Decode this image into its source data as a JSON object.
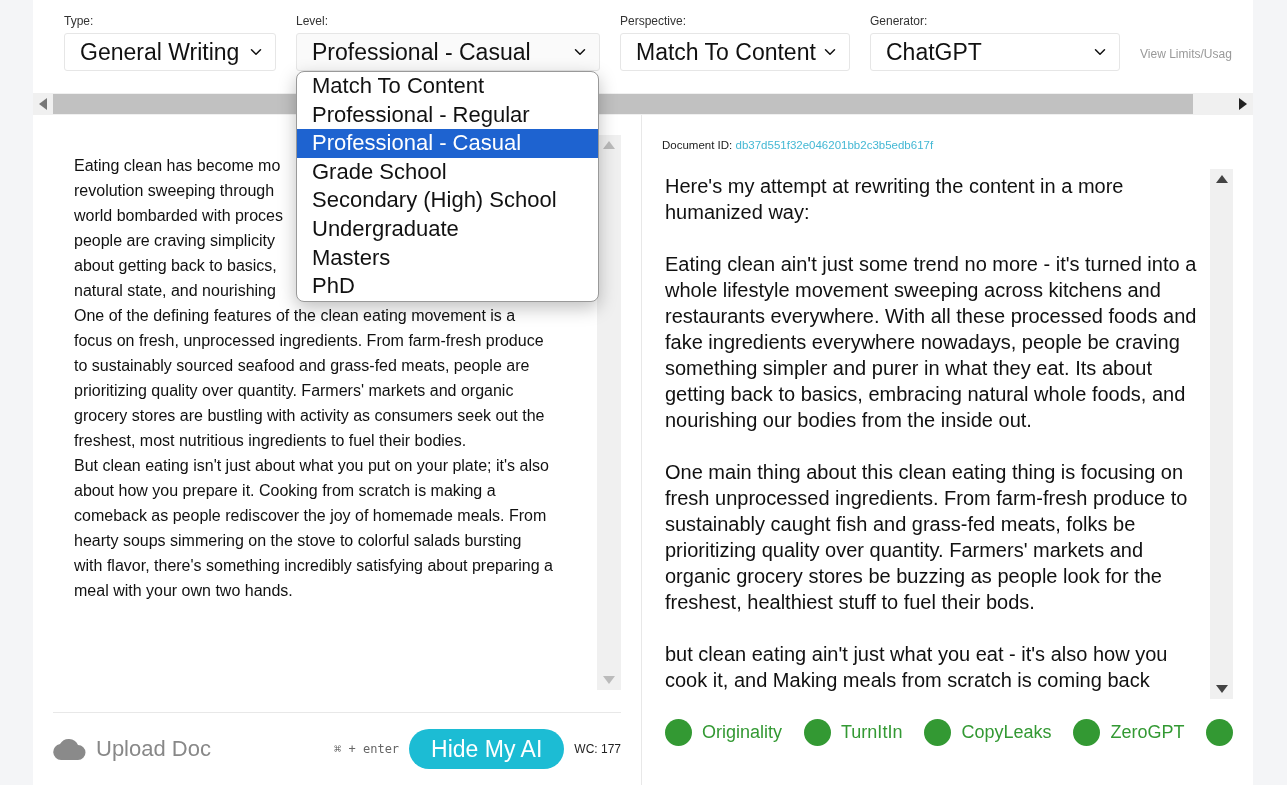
{
  "controls": [
    {
      "label": "Type:",
      "value": "General Writing",
      "open": false
    },
    {
      "label": "Level:",
      "value": "Professional - Casual",
      "open": true
    },
    {
      "label": "Perspective:",
      "value": "Match To Content",
      "open": false
    },
    {
      "label": "Generator:",
      "value": "ChatGPT",
      "open": false
    }
  ],
  "limits_link": "View Limits/Usag",
  "level_options": [
    {
      "label": "Match To Content",
      "selected": false
    },
    {
      "label": "Professional - Regular",
      "selected": false
    },
    {
      "label": "Professional - Casual",
      "selected": true
    },
    {
      "label": "Grade School",
      "selected": false
    },
    {
      "label": "Secondary (High) School",
      "selected": false
    },
    {
      "label": "Undergraduate",
      "selected": false
    },
    {
      "label": "Masters",
      "selected": false
    },
    {
      "label": "PhD",
      "selected": false
    }
  ],
  "input": {
    "covered_lines": [
      "Eating clean has become mo",
      "revolution sweeping through",
      "world bombarded with proces",
      "people are craving simplicity",
      "about getting back to basics,",
      "natural state, and nourishing"
    ],
    "paragraphs": [
      "One of the defining features of the clean eating movement is a focus on fresh, unprocessed ingredients. From farm-fresh produce to sustainably sourced seafood and grass-fed meats, people are prioritizing quality over quantity. Farmers' markets and organic grocery stores are bustling with activity as consumers seek out the freshest, most nutritious ingredients to fuel their bodies.",
      "But clean eating isn't just about what you put on your plate; it's also about how you prepare it. Cooking from scratch is making a comeback as people rediscover the joy of homemade meals. From hearty soups simmering on the stove to colorful salads bursting with flavor, there's something incredibly satisfying about preparing a meal with your own two hands."
    ]
  },
  "upload_label": "Upload Doc",
  "shortcut": "⌘ + enter",
  "submit_label": "Hide My AI",
  "word_count": "WC: 177",
  "output": {
    "document_id_label": "Document ID:",
    "document_id": "db37d551f32e046201bb2c3b5edb617f",
    "paragraphs": [
      "Here's my attempt at rewriting the content in a more humanized way:",
      "Eating clean ain't just some trend no more - it's turned into a whole lifestyle movement sweeping across kitchens and restaurants everywhere.  With all these processed foods and fake ingredients everywhere nowadays, people be craving something simpler and purer in what they eat.  Its about getting back to basics, embracing natural whole foods, and nourishing our bodies from the inside out.",
      "One main thing about this clean eating thing is focusing on fresh unprocessed ingredients.  From farm-fresh produce to sustainably caught fish and grass-fed meats, folks be prioritizing quality over quantity.  Farmers' markets and organic grocery stores be buzzing as people look for the freshest, healthiest stuff to fuel their bods.",
      "but clean eating ain't just what you eat - it's also how you cook it, and  Making meals from scratch is coming back"
    ]
  },
  "detectors": [
    {
      "label": "Originality",
      "color": "#339933"
    },
    {
      "label": "TurnItIn",
      "color": "#339933"
    },
    {
      "label": "CopyLeaks",
      "color": "#339933"
    },
    {
      "label": "ZeroGPT",
      "color": "#339933"
    },
    {
      "color": "#339933"
    }
  ]
}
